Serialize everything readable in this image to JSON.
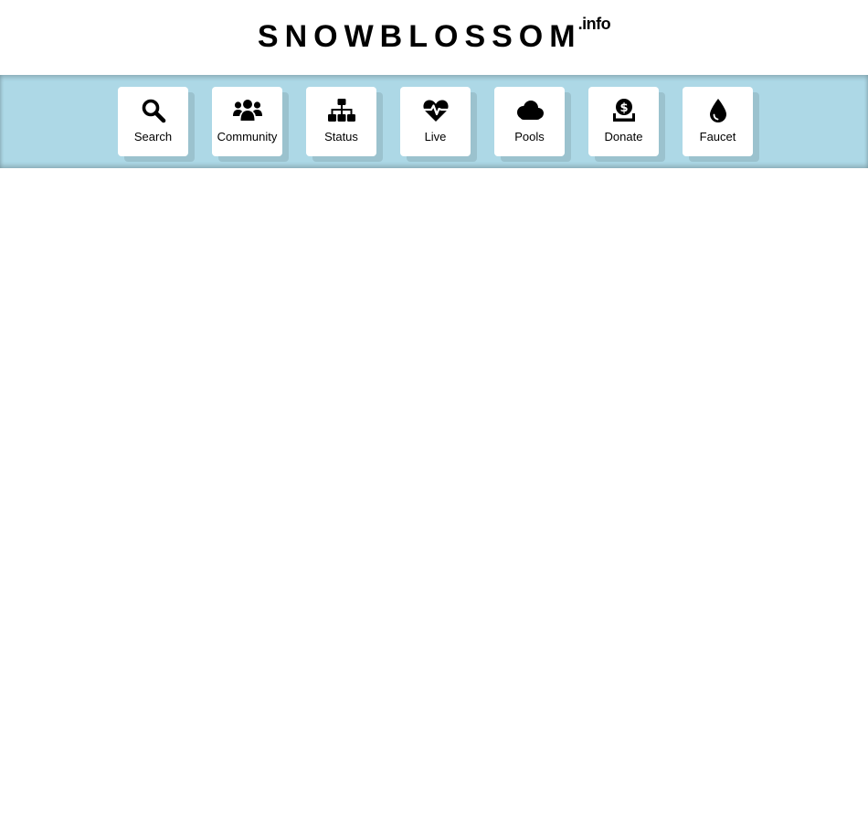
{
  "header": {
    "brand_name": "SNOWBLOSSOM",
    "brand_tld": ".info"
  },
  "nav": {
    "background_color": "#add8e6",
    "items": [
      {
        "label": "Search",
        "icon": "search-icon"
      },
      {
        "label": "Community",
        "icon": "users-icon"
      },
      {
        "label": "Status",
        "icon": "sitemap-icon"
      },
      {
        "label": "Live",
        "icon": "heartbeat-icon"
      },
      {
        "label": "Pools",
        "icon": "cloud-icon"
      },
      {
        "label": "Donate",
        "icon": "donate-icon"
      },
      {
        "label": "Faucet",
        "icon": "tint-icon"
      }
    ]
  }
}
